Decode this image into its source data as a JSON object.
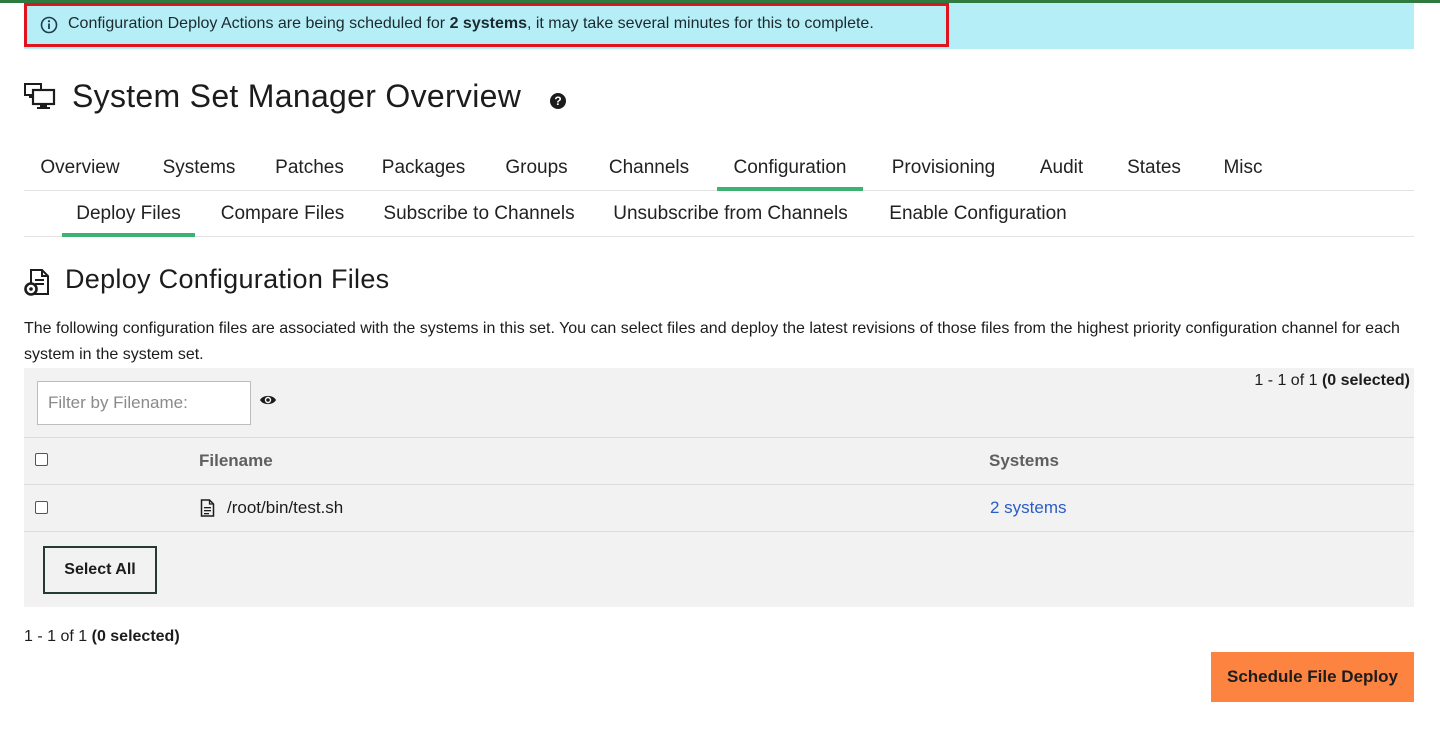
{
  "alert": {
    "text_prefix": "Configuration Deploy Actions are being scheduled for ",
    "text_bold": "2 systems",
    "text_suffix": ", it may take several minutes for this to complete."
  },
  "page": {
    "title": "System Set Manager Overview",
    "help_symbol": "?"
  },
  "tabs": [
    {
      "label": "Overview"
    },
    {
      "label": "Systems"
    },
    {
      "label": "Patches"
    },
    {
      "label": "Packages"
    },
    {
      "label": "Groups"
    },
    {
      "label": "Channels"
    },
    {
      "label": "Configuration",
      "active": true
    },
    {
      "label": "Provisioning"
    },
    {
      "label": "Audit"
    },
    {
      "label": "States"
    },
    {
      "label": "Misc"
    }
  ],
  "subtabs": [
    {
      "label": "Deploy Files",
      "active": true
    },
    {
      "label": "Compare Files"
    },
    {
      "label": "Subscribe to Channels"
    },
    {
      "label": "Unsubscribe from Channels"
    },
    {
      "label": "Enable Configuration"
    }
  ],
  "section": {
    "title": "Deploy Configuration Files",
    "description": "The following configuration files are associated with the systems in this set. You can select files and deploy the latest revisions of those files from the highest priority configuration channel for each system in the system set."
  },
  "table": {
    "filter_placeholder": "Filter by Filename:",
    "pager_range": "1 - 1 of 1",
    "pager_selected": "(0 selected)",
    "columns": {
      "filename": "Filename",
      "systems": "Systems"
    },
    "rows": [
      {
        "filename": "/root/bin/test.sh",
        "systems": "2 systems"
      }
    ],
    "select_all_label": "Select All"
  },
  "actions": {
    "schedule_label": "Schedule File Deploy"
  },
  "colors": {
    "alert_bg": "#b6eef7",
    "alert_outline": "#e0141e",
    "tab_active": "#3cb371",
    "primary_button": "#fd8440",
    "link": "#2a5dc4"
  },
  "icons": {
    "alert": "info-circle-icon",
    "title": "desktop-systems-icon",
    "section": "file-gear-icon",
    "filter_toggle": "eye-icon",
    "row_file": "file-text-icon"
  }
}
